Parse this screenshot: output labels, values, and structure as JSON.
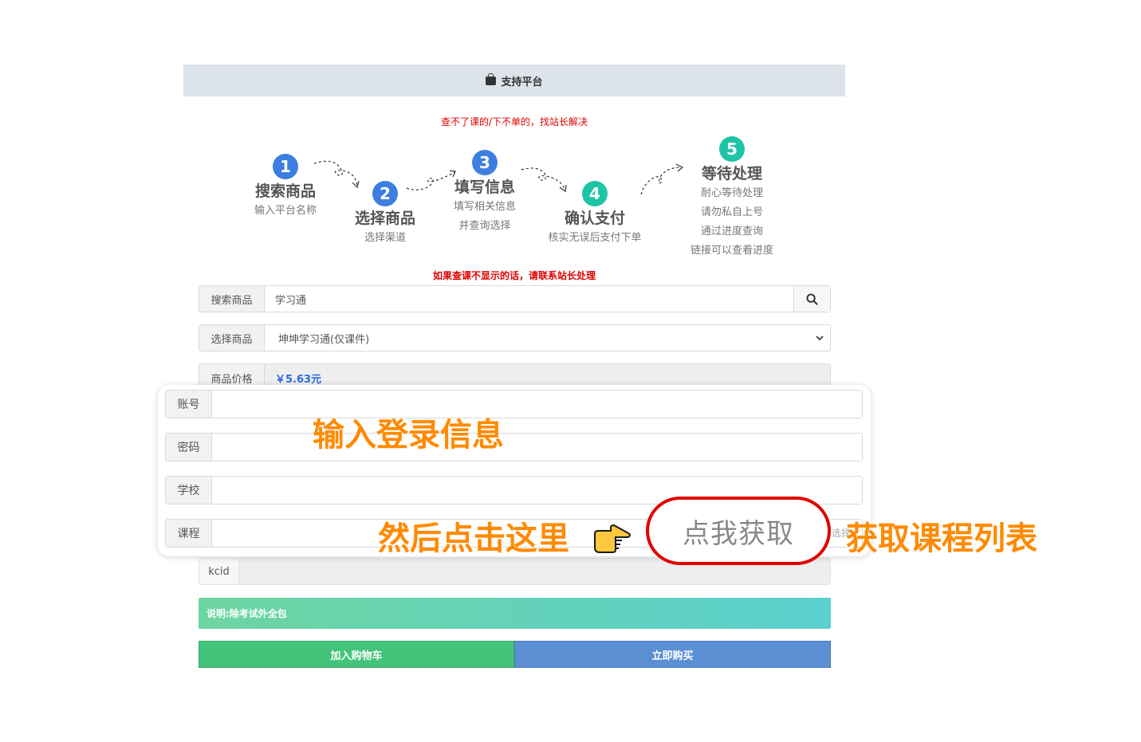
{
  "header": {
    "title": "支持平台",
    "icon": "shopping-bag-icon"
  },
  "notices": {
    "top": "查不了课的/下不单的，找站长解决",
    "bottom": "如果查课不显示的话，请联系站长处理"
  },
  "steps": [
    {
      "num": "1",
      "title": "搜索商品",
      "desc": [
        "输入平台名称"
      ],
      "color": "#3d7fe0"
    },
    {
      "num": "2",
      "title": "选择商品",
      "desc": [
        "选择渠道"
      ],
      "color": "#3d7fe0"
    },
    {
      "num": "3",
      "title": "填写信息",
      "desc": [
        "填写相关信息",
        "并查询选择"
      ],
      "color": "#3d7fe0"
    },
    {
      "num": "4",
      "title": "确认支付",
      "desc": [
        "核实无误后支付下单"
      ],
      "color": "#1ec4a6"
    },
    {
      "num": "5",
      "title": "等待处理",
      "desc": [
        "耐心等待处理",
        "请勿私自上号",
        "通过进度查询",
        "链接可以查看进度"
      ],
      "color": "#1ec4a6"
    }
  ],
  "form": {
    "search": {
      "label": "搜索商品",
      "value": "学习通",
      "icon": "search-icon"
    },
    "select": {
      "label": "选择商品",
      "value": "坤坤学习通(仅课件)",
      "icon": "chevron-down-icon"
    },
    "price": {
      "label": "商品价格",
      "value": "￥5.63元"
    }
  },
  "login": {
    "account": "账号",
    "password": "密码",
    "school": "学校",
    "course": "课程"
  },
  "annotations": {
    "enter_info": "输入登录信息",
    "then_click": "然后点击这里",
    "get_list": "获取课程列表",
    "pointer_icon": "pointing-hand-icon"
  },
  "get_button": "点我获取",
  "partial_text": "选择",
  "kcid": {
    "label": "kcid"
  },
  "alert": "说明:除考试外全包",
  "buttons": {
    "cart": "加入购物车",
    "buy": "立即购买"
  }
}
